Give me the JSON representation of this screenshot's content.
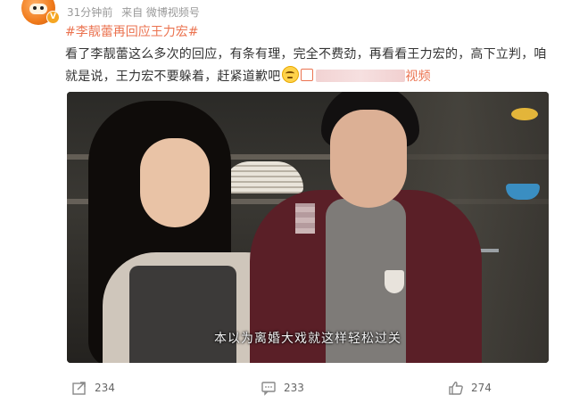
{
  "post": {
    "meta_time": "31分钟前",
    "meta_source": "来自 微博视频号",
    "topic": "#李靓蕾再回应王力宏#",
    "text": "看了李靓蕾这么多次的回应，有条有理，完全不费劲，再看看王力宏的，高下立判，咱就是说，王力宏不要躲着，赶紧道歉吧",
    "link_tail": "视频",
    "verified_badge": "V",
    "avatar_icon": "cartoon-avatar"
  },
  "video": {
    "subtitle": "本以为离婚大戏就这样轻松过关"
  },
  "actions": {
    "share_count": "234",
    "comment_count": "233",
    "like_count": "274"
  },
  "colors": {
    "topic": "#eb7350",
    "meta": "#999999",
    "text": "#333333"
  }
}
